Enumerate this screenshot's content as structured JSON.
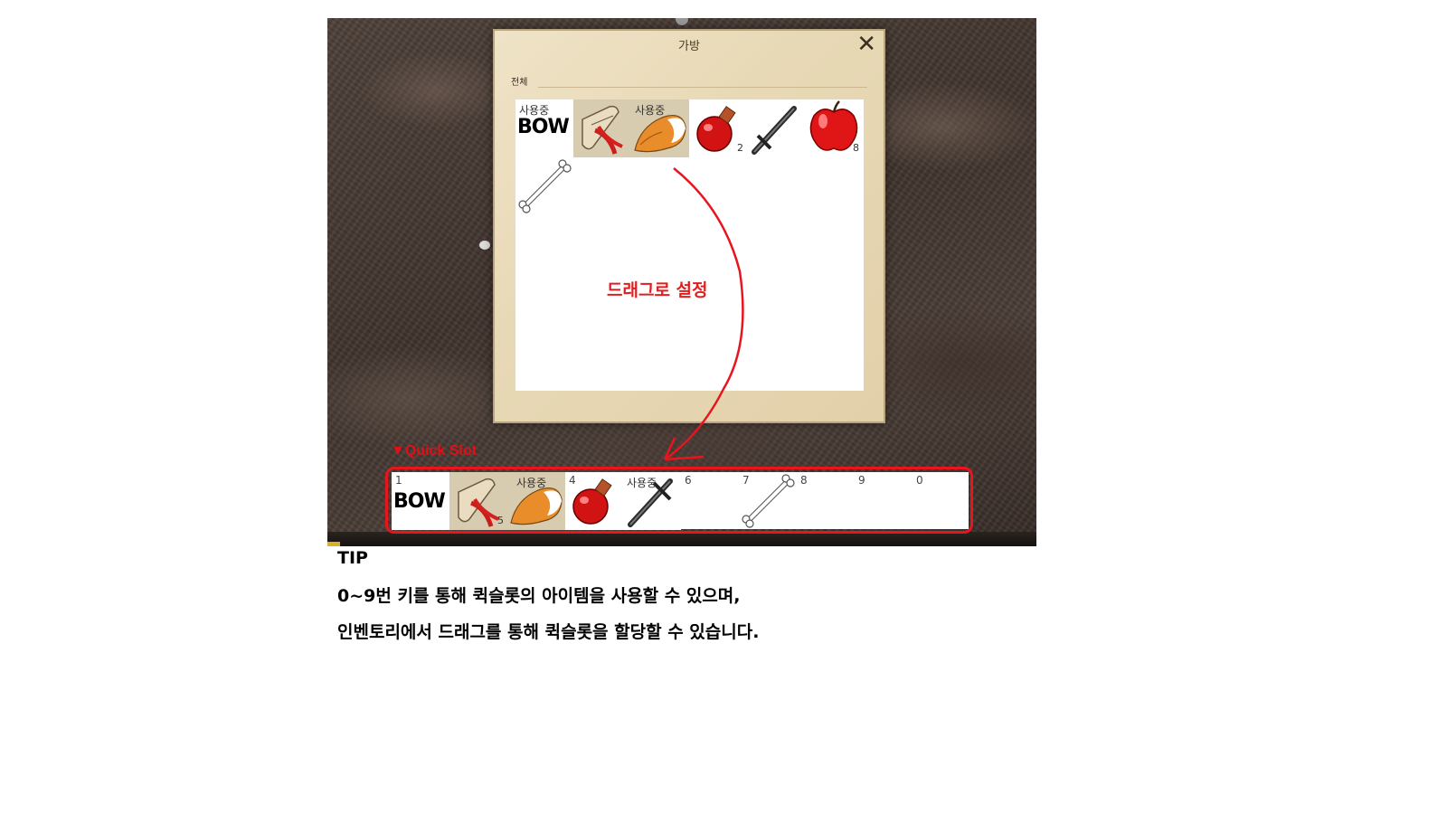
{
  "bag": {
    "title": "가방",
    "close_glyph": "✕",
    "tab_all": "전체",
    "items": [
      {
        "icon": "bow-item",
        "in_use": "사용중",
        "text": "BOW",
        "count": ""
      },
      {
        "icon": "scroll-icon",
        "in_use": "",
        "text": "",
        "count": ""
      },
      {
        "icon": "fox-tail-icon",
        "in_use": "사용중",
        "text": "",
        "count": ""
      },
      {
        "icon": "red-potion-icon",
        "in_use": "",
        "text": "",
        "count": "2"
      },
      {
        "icon": "sword-icon",
        "in_use": "",
        "text": "",
        "count": ""
      },
      {
        "icon": "apple-icon",
        "in_use": "",
        "text": "",
        "count": "8"
      },
      {
        "icon": "bone-icon",
        "in_use": "",
        "text": "",
        "count": ""
      }
    ]
  },
  "annotation": {
    "drag_text": "드래그로 설정",
    "quick_slot_label": "▼Quick Slot",
    "arrow_color": "#e8141e"
  },
  "quick_slot": {
    "slots": [
      {
        "key": "1",
        "icon": "bow-item",
        "text": "BOW",
        "in_use": "",
        "count": ""
      },
      {
        "key": "",
        "icon": "scroll-icon",
        "text": "",
        "in_use": "",
        "count": "5"
      },
      {
        "key": "",
        "icon": "fox-tail-icon",
        "text": "",
        "in_use": "사용중",
        "count": ""
      },
      {
        "key": "4",
        "icon": "red-potion-icon",
        "text": "",
        "in_use": "",
        "count": ""
      },
      {
        "key": "",
        "icon": "sword-icon",
        "text": "",
        "in_use": "사용중",
        "count": ""
      },
      {
        "key": "6",
        "icon": "",
        "text": "",
        "in_use": "",
        "count": ""
      },
      {
        "key": "7",
        "icon": "bone-icon",
        "text": "",
        "in_use": "",
        "count": ""
      },
      {
        "key": "8",
        "icon": "",
        "text": "",
        "in_use": "",
        "count": ""
      },
      {
        "key": "9",
        "icon": "",
        "text": "",
        "in_use": "",
        "count": ""
      },
      {
        "key": "0",
        "icon": "",
        "text": "",
        "in_use": "",
        "count": ""
      }
    ]
  },
  "tip": {
    "title": "TIP",
    "line1": "0~9번 키를 통해 퀵슬롯의 아이템을 사용할 수 있으며,",
    "line2": "인벤토리에서 드래그를 통해 퀵슬롯을 할당할 수 있습니다."
  }
}
